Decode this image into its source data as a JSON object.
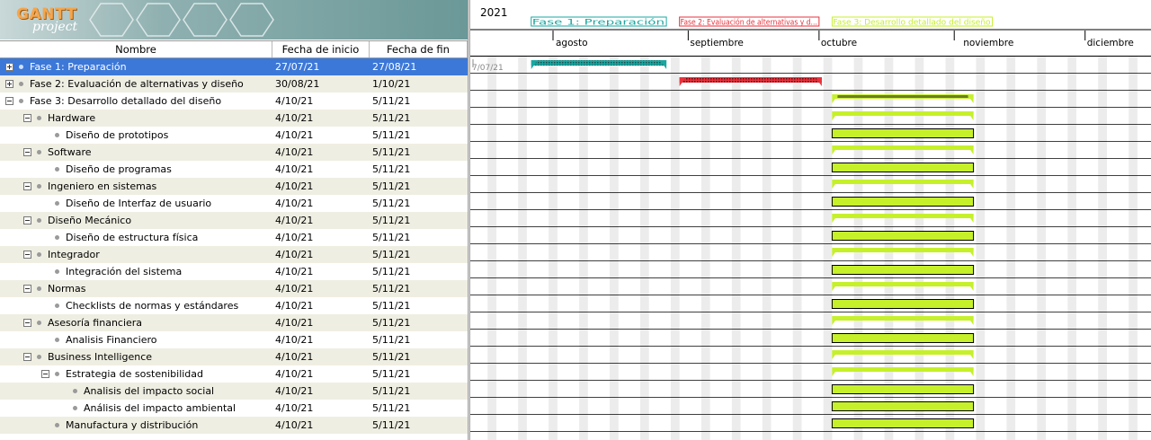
{
  "app": {
    "logo_word": "GANTT",
    "logo_sub": "project"
  },
  "table": {
    "headers": {
      "name": "Nombre",
      "start": "Fecha de inicio",
      "end": "Fecha de fin"
    },
    "rows": [
      {
        "name": "Fase 1: Preparación",
        "start": "27/07/21",
        "end": "27/08/21",
        "level": 0,
        "toggle": "plus",
        "selected": true
      },
      {
        "name": "Fase 2: Evaluación  de  alternativas  y diseño",
        "start": "30/08/21",
        "end": "1/10/21",
        "level": 0,
        "toggle": "plus"
      },
      {
        "name": "Fase 3: Desarrollo  detallado  del diseño",
        "start": "4/10/21",
        "end": "5/11/21",
        "level": 0,
        "toggle": "minus"
      },
      {
        "name": "Hardware",
        "start": "4/10/21",
        "end": "5/11/21",
        "level": 1,
        "toggle": "minus"
      },
      {
        "name": "Diseño de prototipos",
        "start": "4/10/21",
        "end": "5/11/21",
        "level": 2,
        "toggle": "none"
      },
      {
        "name": "Software",
        "start": "4/10/21",
        "end": "5/11/21",
        "level": 1,
        "toggle": "minus"
      },
      {
        "name": "Diseño de programas",
        "start": "4/10/21",
        "end": "5/11/21",
        "level": 2,
        "toggle": "none"
      },
      {
        "name": "Ingeniero en sistemas",
        "start": "4/10/21",
        "end": "5/11/21",
        "level": 1,
        "toggle": "minus"
      },
      {
        "name": "Diseño de Interfaz de usuario",
        "start": "4/10/21",
        "end": "5/11/21",
        "level": 2,
        "toggle": "none"
      },
      {
        "name": "Diseño Mecánico",
        "start": "4/10/21",
        "end": "5/11/21",
        "level": 1,
        "toggle": "minus"
      },
      {
        "name": "Diseño de estructura física",
        "start": "4/10/21",
        "end": "5/11/21",
        "level": 2,
        "toggle": "none"
      },
      {
        "name": "Integrador",
        "start": "4/10/21",
        "end": "5/11/21",
        "level": 1,
        "toggle": "minus"
      },
      {
        "name": "Integración del sistema",
        "start": "4/10/21",
        "end": "5/11/21",
        "level": 2,
        "toggle": "none"
      },
      {
        "name": "Normas",
        "start": "4/10/21",
        "end": "5/11/21",
        "level": 1,
        "toggle": "minus"
      },
      {
        "name": "Checklists de normas y estándares",
        "start": "4/10/21",
        "end": "5/11/21",
        "level": 2,
        "toggle": "none"
      },
      {
        "name": "Asesoría financiera",
        "start": "4/10/21",
        "end": "5/11/21",
        "level": 1,
        "toggle": "minus"
      },
      {
        "name": "Analisis Financiero",
        "start": "4/10/21",
        "end": "5/11/21",
        "level": 2,
        "toggle": "none"
      },
      {
        "name": "Business Intelligence",
        "start": "4/10/21",
        "end": "5/11/21",
        "level": 1,
        "toggle": "minus"
      },
      {
        "name": "Estrategia de sostenibilidad",
        "start": "4/10/21",
        "end": "5/11/21",
        "level": 2,
        "toggle": "minus"
      },
      {
        "name": "Analisis del impacto social",
        "start": "4/10/21",
        "end": "5/11/21",
        "level": 3,
        "toggle": "none"
      },
      {
        "name": "Análisis del impacto ambiental",
        "start": "4/10/21",
        "end": "5/11/21",
        "level": 3,
        "toggle": "none"
      },
      {
        "name": "Manufactura y distribución",
        "start": "4/10/21",
        "end": "5/11/21",
        "level": 2,
        "toggle": "none"
      }
    ]
  },
  "timeline": {
    "year": "2021",
    "months": [
      "agosto",
      "septiembre",
      "octubre",
      "noviembre",
      "diciembre"
    ],
    "today_marker": "7/07/21",
    "phase_labels": [
      {
        "text": "Fase 1: Preparación",
        "color": "#1aa7a1"
      },
      {
        "text": "Fase 2: Evaluación  de  alternativas  y d...",
        "color": "#e8323c"
      },
      {
        "text": "Fase 3: Desarrollo  detallado  del diseño",
        "color": "#c2ea3a"
      }
    ],
    "colors": {
      "phase1": "#1aa7a1",
      "phase2": "#e8323c",
      "task": "#c6f02a",
      "summary": "#6b7f1a",
      "weekend": "#ececec"
    }
  }
}
